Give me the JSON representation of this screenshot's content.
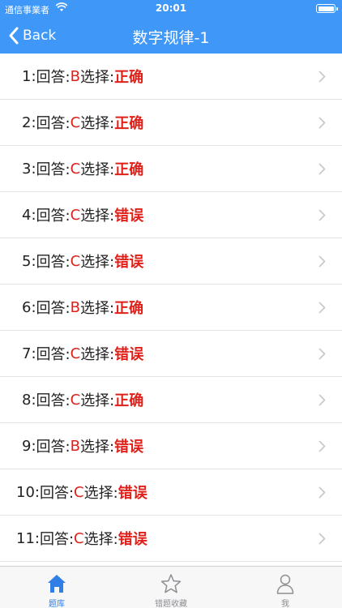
{
  "status_bar": {
    "carrier": "通信事業者",
    "time": "20:01"
  },
  "nav": {
    "back_label": "Back",
    "title": "数字规律-1"
  },
  "rows": [
    {
      "num": "1:",
      "answer_label": "回答:",
      "answer": "B",
      "choice_label": "选择:",
      "result": "正确"
    },
    {
      "num": "2:",
      "answer_label": "回答:",
      "answer": "C",
      "choice_label": "选择:",
      "result": "正确"
    },
    {
      "num": "3:",
      "answer_label": "回答:",
      "answer": "C",
      "choice_label": "选择:",
      "result": "正确"
    },
    {
      "num": "4:",
      "answer_label": "回答:",
      "answer": "C",
      "choice_label": "选择:",
      "result": "错误"
    },
    {
      "num": "5:",
      "answer_label": "回答:",
      "answer": "C",
      "choice_label": "选择:",
      "result": "错误"
    },
    {
      "num": "6:",
      "answer_label": "回答:",
      "answer": "B",
      "choice_label": "选择:",
      "result": "正确"
    },
    {
      "num": "7:",
      "answer_label": "回答:",
      "answer": "C",
      "choice_label": "选择:",
      "result": "错误"
    },
    {
      "num": "8:",
      "answer_label": "回答:",
      "answer": "C",
      "choice_label": "选择:",
      "result": "正确"
    },
    {
      "num": "9:",
      "answer_label": "回答:",
      "answer": "B",
      "choice_label": "选择:",
      "result": "错误"
    },
    {
      "num": "10:",
      "answer_label": "回答:",
      "answer": "C",
      "choice_label": "选择:",
      "result": "错误"
    },
    {
      "num": "11:",
      "answer_label": "回答:",
      "answer": "C",
      "choice_label": "选择:",
      "result": "错误"
    }
  ],
  "tabbar": {
    "tabs": [
      {
        "label": "题库",
        "icon": "home-icon",
        "active": true
      },
      {
        "label": "错题收藏",
        "icon": "star-icon",
        "active": false
      },
      {
        "label": "我",
        "icon": "person-icon",
        "active": false
      }
    ]
  },
  "colors": {
    "nav_bg": "#3f97f7",
    "accent_red": "#e0211a",
    "tab_active": "#2f7fe6",
    "tab_inactive": "#8e8e93"
  }
}
